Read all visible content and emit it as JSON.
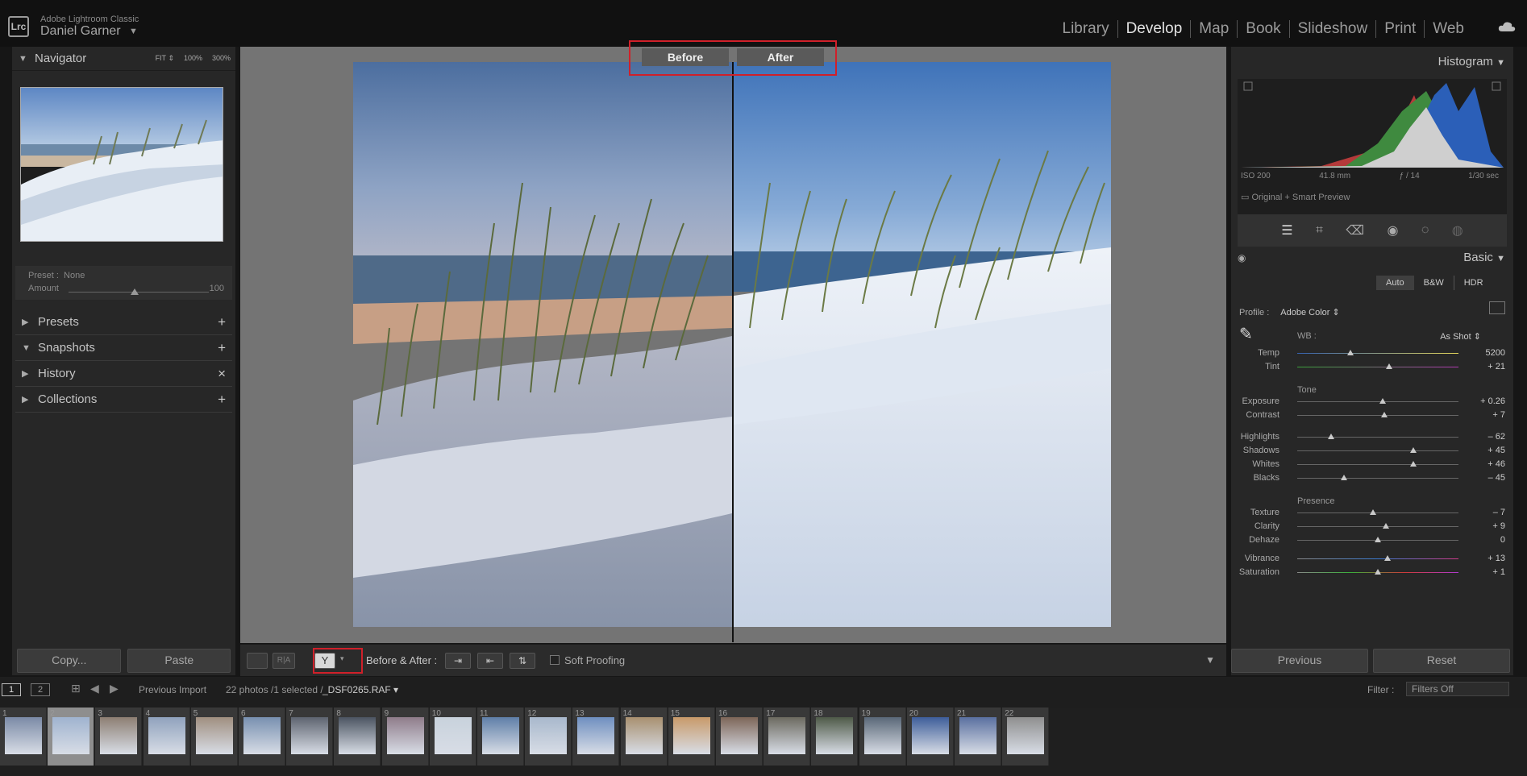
{
  "app": {
    "name": "Adobe Lightroom Classic",
    "logo": "Lrc",
    "user": "Daniel Garner"
  },
  "modules": [
    "Library",
    "Develop",
    "Map",
    "Book",
    "Slideshow",
    "Print",
    "Web"
  ],
  "active_module": "Develop",
  "navigator": {
    "title": "Navigator",
    "zoom_options": [
      "FIT ⇕",
      "100%",
      "300%"
    ]
  },
  "preset": {
    "label": "Preset :",
    "value": "None",
    "amount_label": "Amount",
    "amount_value": "100",
    "amount_fraction": 0.47
  },
  "left_groups": [
    {
      "label": "Presets",
      "action": "+"
    },
    {
      "label": "Snapshots",
      "action": "+"
    },
    {
      "label": "History",
      "action": "×"
    },
    {
      "label": "Collections",
      "action": "+"
    }
  ],
  "left_buttons": {
    "copy": "Copy...",
    "paste": "Paste"
  },
  "compare": {
    "before": "Before",
    "after": "After"
  },
  "toolbar": {
    "ba_label": "Before & After :",
    "soft_proofing": "Soft Proofing"
  },
  "histogram": {
    "title": "Histogram",
    "iso": "ISO 200",
    "focal": "41.8 mm",
    "aperture": "ƒ / 14",
    "shutter": "1/30 sec",
    "preview": "Original + Smart Preview"
  },
  "basic": {
    "title": "Basic",
    "treatment": [
      "Auto",
      "B&W",
      "HDR"
    ],
    "profile_label": "Profile :",
    "profile_value": "Adobe Color ⇕",
    "wb_label": "WB :",
    "wb_value": "As Shot ⇕",
    "tone_label": "Tone",
    "presence_label": "Presence"
  },
  "sliders": [
    {
      "label": "Temp",
      "value": "5200",
      "fraction": 0.33
    },
    {
      "label": "Tint",
      "value": "+ 21",
      "fraction": 0.57
    },
    {
      "label": "Exposure",
      "value": "+ 0.26",
      "fraction": 0.53
    },
    {
      "label": "Contrast",
      "value": "+ 7",
      "fraction": 0.54
    },
    {
      "label": "Highlights",
      "value": "– 62",
      "fraction": 0.21
    },
    {
      "label": "Shadows",
      "value": "+ 45",
      "fraction": 0.72
    },
    {
      "label": "Whites",
      "value": "+ 46",
      "fraction": 0.72
    },
    {
      "label": "Blacks",
      "value": "– 45",
      "fraction": 0.29
    },
    {
      "label": "Texture",
      "value": "– 7",
      "fraction": 0.47
    },
    {
      "label": "Clarity",
      "value": "+ 9",
      "fraction": 0.55
    },
    {
      "label": "Dehaze",
      "value": "0",
      "fraction": 0.5
    },
    {
      "label": "Vibrance",
      "value": "+ 13",
      "fraction": 0.56
    },
    {
      "label": "Saturation",
      "value": "+ 1",
      "fraction": 0.5
    }
  ],
  "right_buttons": {
    "previous": "Previous",
    "reset": "Reset"
  },
  "filmbar": {
    "screen1": "1",
    "screen2": "2",
    "source": "Previous Import",
    "count": "22 photos /1 selected /",
    "file": "_DSF0265.RAF",
    "filter_label": "Filter :",
    "filter_value": "Filters Off"
  },
  "film_numbers": [
    "1",
    "2",
    "3",
    "4",
    "5",
    "6",
    "7",
    "8",
    "9",
    "10",
    "11",
    "12",
    "13",
    "14",
    "15",
    "16",
    "17",
    "18",
    "19",
    "20",
    "21",
    "22"
  ],
  "colors": {
    "accent_red": "#d0202a",
    "panel": "#272727",
    "background": "#747474"
  }
}
